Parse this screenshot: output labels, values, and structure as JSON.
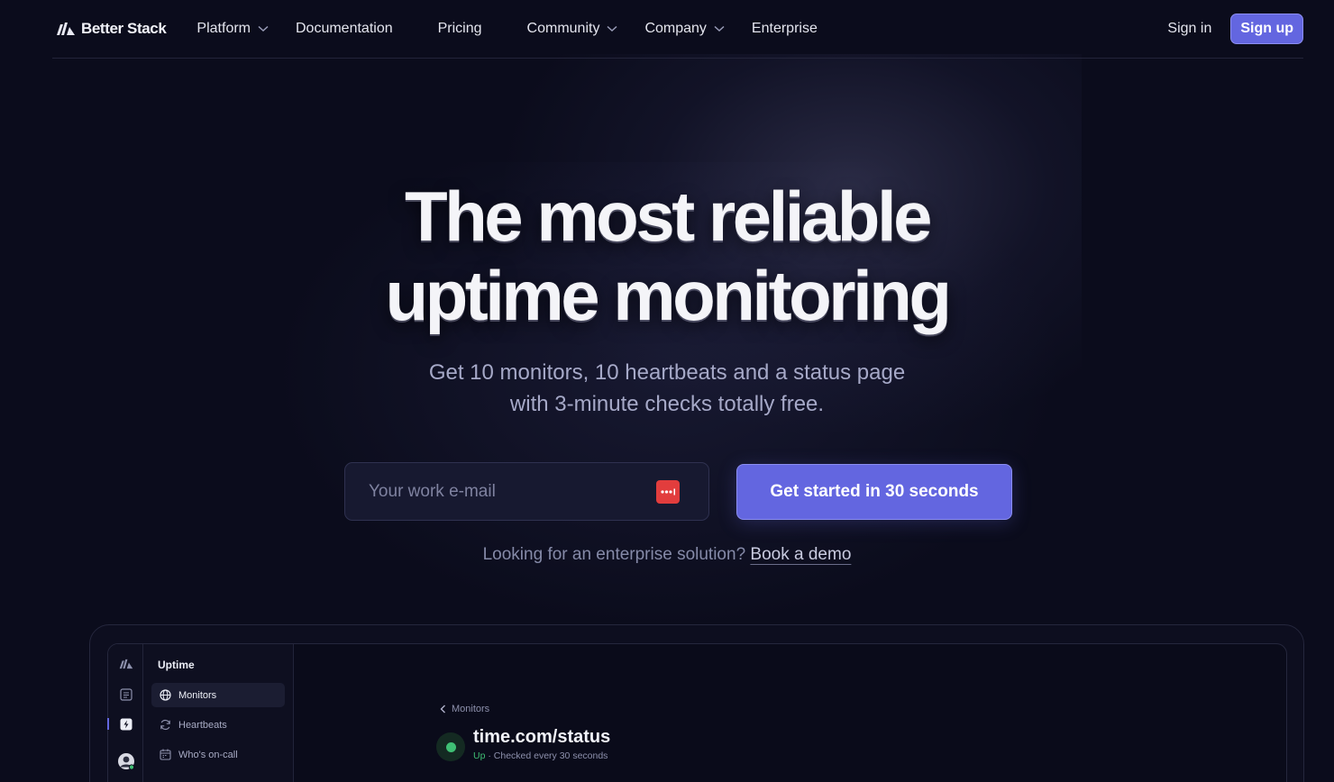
{
  "nav": {
    "logo_text": "Better Stack",
    "links": [
      {
        "label": "Platform",
        "has_dropdown": true
      },
      {
        "label": "Documentation",
        "has_dropdown": false
      },
      {
        "label": "Pricing",
        "has_dropdown": false
      },
      {
        "label": "Community",
        "has_dropdown": true
      },
      {
        "label": "Company",
        "has_dropdown": true
      },
      {
        "label": "Enterprise",
        "has_dropdown": false
      }
    ],
    "sign_in": "Sign in",
    "sign_up": "Sign up"
  },
  "hero": {
    "title_line1": "The most reliable",
    "title_line2": "uptime monitoring",
    "subtitle_line1": "Get 10 monitors, 10 heartbeats and a status page",
    "subtitle_line2": "with 3-minute checks totally free.",
    "email_placeholder": "Your work e-mail",
    "cta_label": "Get started in 30 seconds",
    "enterprise_text": "Looking for an enterprise solution?",
    "enterprise_link": "Book a demo"
  },
  "app_preview": {
    "sidebar_title": "Uptime",
    "sidebar_items": [
      {
        "label": "Monitors",
        "icon": "globe-icon",
        "active": true
      },
      {
        "label": "Heartbeats",
        "icon": "refresh-icon",
        "active": false
      },
      {
        "label": "Who's on-call",
        "icon": "calendar-icon",
        "active": false
      }
    ],
    "back_label": "Monitors",
    "monitor_name": "time.com/status",
    "monitor_status": "Up",
    "monitor_meta": " · Checked every 30 seconds"
  },
  "colors": {
    "background": "#0b0c1c",
    "accent": "#6366e0",
    "status_up": "#3fbf74",
    "password_manager_icon": "#e23d3d"
  }
}
